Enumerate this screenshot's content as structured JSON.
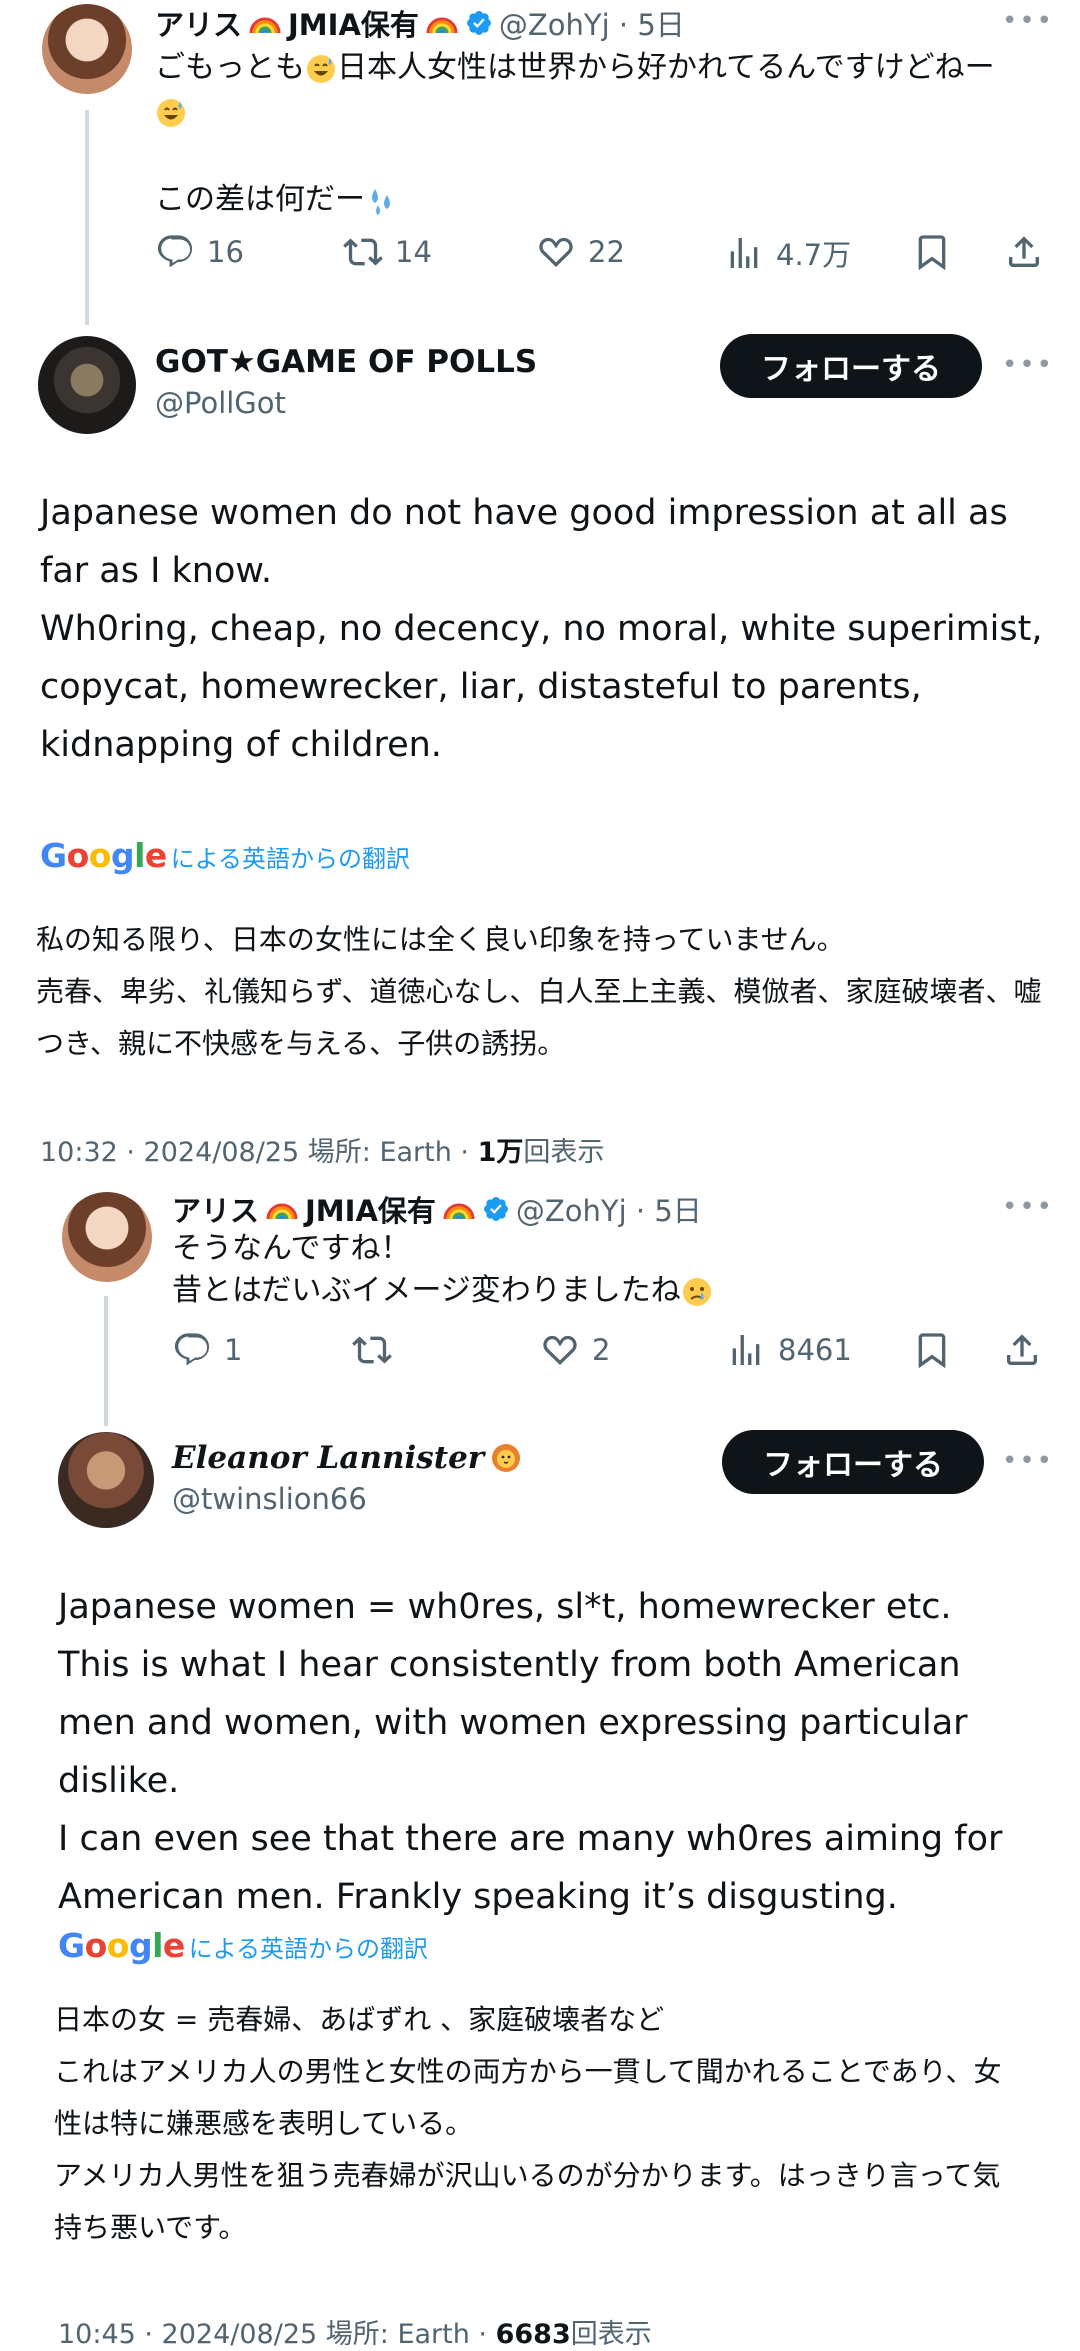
{
  "tweet1": {
    "name": "アリス",
    "name_suffix": "JMIA保有",
    "handle_time": "@ZohYj · 5日",
    "line1": "ごもっとも",
    "line1b": "日本人女性は世界から好かれてるんですけどねー",
    "line3": "この差は何だー",
    "replies": "16",
    "retweets": "14",
    "likes": "22",
    "views": "4.7万"
  },
  "tweet2": {
    "name": "GOT★GAME OF POLLS",
    "handle": "@PollGot",
    "follow_label": "フォローする",
    "text": "Japanese women do not have good impression at all as far as I know.\nWh0ring, cheap, no decency, no moral, white superimist, copycat, homewrecker, liar, distasteful to parents, kidnapping of children.",
    "translate_label": "による英語からの翻訳",
    "translation": "私の知る限り、日本の女性には全く良い印象を持っていません。\n売春、卑劣、礼儀知らず、道徳心なし、白人至上主義、模倣者、家庭破壊者、嘘つき、親に不快感を与える、子供の誘拐。",
    "meta_prefix": "10:32 · 2024/08/25 場所: Earth · ",
    "meta_views": "1万",
    "meta_suffix": "回表示"
  },
  "tweet3": {
    "name": "アリス",
    "name_suffix": "JMIA保有",
    "handle_time": "@ZohYj · 5日",
    "line1": "そうなんですね！",
    "line2": "昔とはだいぶイメージ変わりましたね",
    "replies": "1",
    "retweets": "",
    "likes": "2",
    "views": "8461"
  },
  "tweet4": {
    "name": "Eleanor Lannister",
    "handle": "@twinslion66",
    "follow_label": "フォローする",
    "text": "Japanese women = wh0res, sl*t, homewrecker etc.\nThis is what I hear consistently from both American men and women, with women expressing particular dislike.\nI can even see that there are many wh0res aiming for American men. Frankly speaking it’s disgusting.",
    "translate_label": "による英語からの翻訳",
    "translation": "日本の女 = 売春婦、あばずれ 、家庭破壊者など\nこれはアメリカ人の男性と女性の両方から一貫して聞かれることであり、女性は特に嫌悪感を表明している。\nアメリカ人男性を狙う売春婦が沢山いるのが分かります。はっきり言って気持ち悪いです。",
    "meta_prefix": "10:45 · 2024/08/25 場所: Earth · ",
    "meta_views": "6683",
    "meta_suffix": "回表示"
  },
  "google_wordmark": "Google",
  "icons": [
    "reply-icon",
    "retweet-icon",
    "like-icon",
    "views-icon",
    "bookmark-icon",
    "share-icon",
    "verified-icon",
    "more-icon"
  ],
  "colors": {
    "accent": "#1d9bf0",
    "muted": "#536471",
    "text": "#0f1419",
    "follow_bg": "#0f1419"
  }
}
